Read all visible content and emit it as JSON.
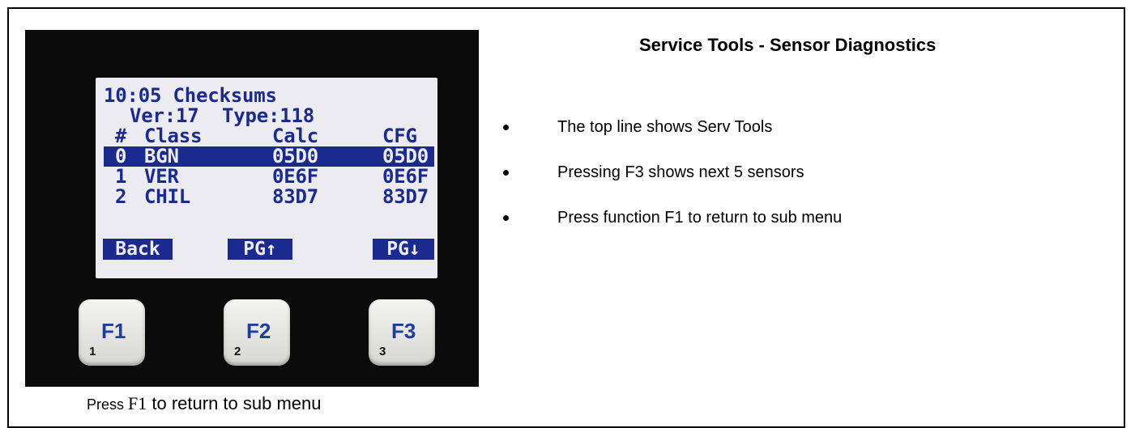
{
  "title": "Service Tools - Sensor Diagnostics",
  "lcd": {
    "line1": "10:05 Checksums",
    "line2": "Ver:17  Type:118",
    "headers": [
      "#",
      "Class",
      "Calc",
      "CFG"
    ],
    "rows": [
      {
        "num": "0",
        "class": "BGN",
        "calc": "05D0",
        "cfg": "05D0",
        "selected": true
      },
      {
        "num": "1",
        "class": "VER",
        "calc": "0E6F",
        "cfg": "0E6F",
        "selected": false
      },
      {
        "num": "2",
        "class": "CHIL",
        "calc": "83D7",
        "cfg": "83D7",
        "selected": false
      }
    ],
    "softkeys": {
      "left": "Back",
      "middle": "PG↑",
      "right": "PG↓"
    }
  },
  "keys": [
    {
      "label": "F1",
      "number": "1"
    },
    {
      "label": "F2",
      "number": "2"
    },
    {
      "label": "F3",
      "number": "3"
    }
  ],
  "caption": {
    "prefix": "Press ",
    "key": "F1",
    "suffix": " to return to sub menu"
  },
  "bullets": [
    "The top line shows Serv Tools",
    "Pressing  F3 shows next 5 sensors",
    "Press function F1 to return to sub menu"
  ],
  "colors": {
    "lcd_text": "#1b2a8e",
    "lcd_background": "#ececf0",
    "key_label": "#1c3e9c"
  }
}
